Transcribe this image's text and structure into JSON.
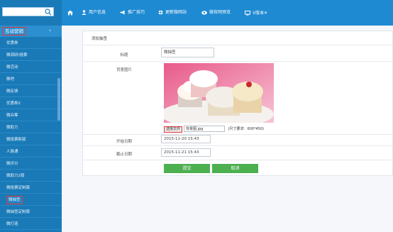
{
  "sidebar": {
    "search_placeholder": "",
    "group_label": "互动营销",
    "group_chevron": "›",
    "items": [
      {
        "label": "优惠券"
      },
      {
        "label": "微调研/投票"
      },
      {
        "label": "微活动"
      },
      {
        "label": "微吧"
      },
      {
        "label": "微反馈"
      },
      {
        "label": "优惠券2"
      },
      {
        "label": "微众筹"
      },
      {
        "label": "微助力"
      },
      {
        "label": "微投票新版"
      },
      {
        "label": "人脉通"
      },
      {
        "label": "微评分"
      },
      {
        "label": "微助力2版"
      },
      {
        "label": "微投票定制版"
      },
      {
        "label": "微抽签"
      },
      {
        "label": "微抽签定制版"
      },
      {
        "label": "微打造"
      }
    ],
    "active_index": 13
  },
  "topbar": {
    "items": [
      {
        "label": "",
        "icon": "home-icon"
      },
      {
        "label": "用户信息",
        "icon": "user-icon"
      },
      {
        "label": "推广技巧",
        "icon": "megaphone-icon"
      },
      {
        "label": "更新微网站",
        "icon": "globe-icon"
      },
      {
        "label": "微官网预览",
        "icon": "eye-icon"
      },
      {
        "label": "V版本",
        "icon": "monitor-icon",
        "suffix": "»"
      }
    ]
  },
  "form": {
    "card_title": "添加抽签",
    "title_label": "标题",
    "title_value": "微抽签",
    "bg_label": "背景图片",
    "file_button": "选择文件",
    "file_name": "背景图.jpg",
    "size_hint": "(尺寸要求：600*450)",
    "start_label": "开始日期",
    "start_value": "2015-11-20 15:43",
    "end_label": "截止日期",
    "end_value": "2015-11-21 15:43",
    "submit_label": "提交",
    "cancel_label": "取消"
  },
  "colors": {
    "sidebar_bg": "#1a7ab8",
    "topbar_bg": "#1e8ad2",
    "highlight": "#e53935",
    "button_green": "#4caf50"
  }
}
